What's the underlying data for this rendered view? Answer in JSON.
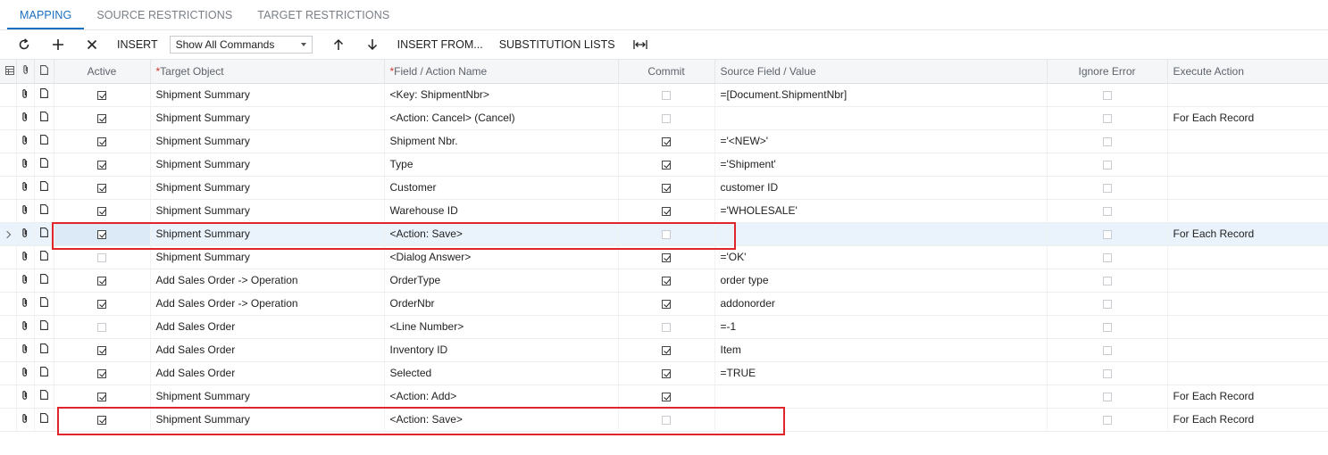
{
  "tabs": [
    {
      "label": "MAPPING",
      "active": true
    },
    {
      "label": "SOURCE RESTRICTIONS",
      "active": false
    },
    {
      "label": "TARGET RESTRICTIONS",
      "active": false
    }
  ],
  "toolbar": {
    "insert_label": "INSERT",
    "commands_select_value": "Show All Commands",
    "insert_from_label": "INSERT FROM...",
    "substitution_lists_label": "SUBSTITUTION LISTS"
  },
  "columns": {
    "active": "Active",
    "target_object": "Target Object",
    "field_action": "Field / Action Name",
    "commit": "Commit",
    "source_value": "Source Field / Value",
    "ignore_error": "Ignore Error",
    "execute_action": "Execute Action"
  },
  "rows": [
    {
      "active": true,
      "target": "Shipment Summary",
      "field": "<Key: ShipmentNbr>",
      "commit": false,
      "source": "=[Document.ShipmentNbr]",
      "ignore": false,
      "execute": ""
    },
    {
      "active": true,
      "target": "Shipment Summary",
      "field": "<Action: Cancel> (Cancel)",
      "commit": false,
      "source": "",
      "ignore": false,
      "execute": "For Each Record"
    },
    {
      "active": true,
      "target": "Shipment Summary",
      "field": "Shipment Nbr.",
      "commit": true,
      "source": "='<NEW>'",
      "ignore": false,
      "execute": ""
    },
    {
      "active": true,
      "target": "Shipment Summary",
      "field": "Type",
      "commit": true,
      "source": "='Shipment'",
      "ignore": false,
      "execute": ""
    },
    {
      "active": true,
      "target": "Shipment Summary",
      "field": "Customer",
      "commit": true,
      "source": "customer ID",
      "ignore": false,
      "execute": ""
    },
    {
      "active": true,
      "target": "Shipment Summary",
      "field": "Warehouse ID",
      "commit": true,
      "source": "='WHOLESALE'",
      "ignore": false,
      "execute": ""
    },
    {
      "active": true,
      "target": "Shipment Summary",
      "field": "<Action: Save>",
      "commit": false,
      "source": "",
      "ignore": false,
      "execute": "For Each Record",
      "selected": true
    },
    {
      "active": false,
      "target": "Shipment Summary",
      "field": "<Dialog Answer>",
      "commit": true,
      "source": "='OK'",
      "ignore": false,
      "execute": ""
    },
    {
      "active": true,
      "target": "Add Sales Order -> Operation",
      "field": "OrderType",
      "commit": true,
      "source": "order type",
      "ignore": false,
      "execute": ""
    },
    {
      "active": true,
      "target": "Add Sales Order -> Operation",
      "field": "OrderNbr",
      "commit": true,
      "source": "addonorder",
      "ignore": false,
      "execute": ""
    },
    {
      "active": false,
      "target": "Add Sales Order",
      "field": "<Line Number>",
      "commit": false,
      "source": "=-1",
      "ignore": false,
      "execute": ""
    },
    {
      "active": true,
      "target": "Add Sales Order",
      "field": "Inventory ID",
      "commit": true,
      "source": "Item",
      "ignore": false,
      "execute": ""
    },
    {
      "active": true,
      "target": "Add Sales Order",
      "field": "Selected",
      "commit": true,
      "source": "=TRUE",
      "ignore": false,
      "execute": ""
    },
    {
      "active": true,
      "target": "Shipment Summary",
      "field": "<Action: Add>",
      "commit": true,
      "source": "",
      "ignore": false,
      "execute": "For Each Record"
    },
    {
      "active": true,
      "target": "Shipment Summary",
      "field": "<Action: Save>",
      "commit": false,
      "source": "",
      "ignore": false,
      "execute": "For Each Record"
    }
  ],
  "colors": {
    "accent": "#1a6fc0",
    "highlight_box": "#e0252b",
    "selected_row": "#eaf2fb"
  }
}
